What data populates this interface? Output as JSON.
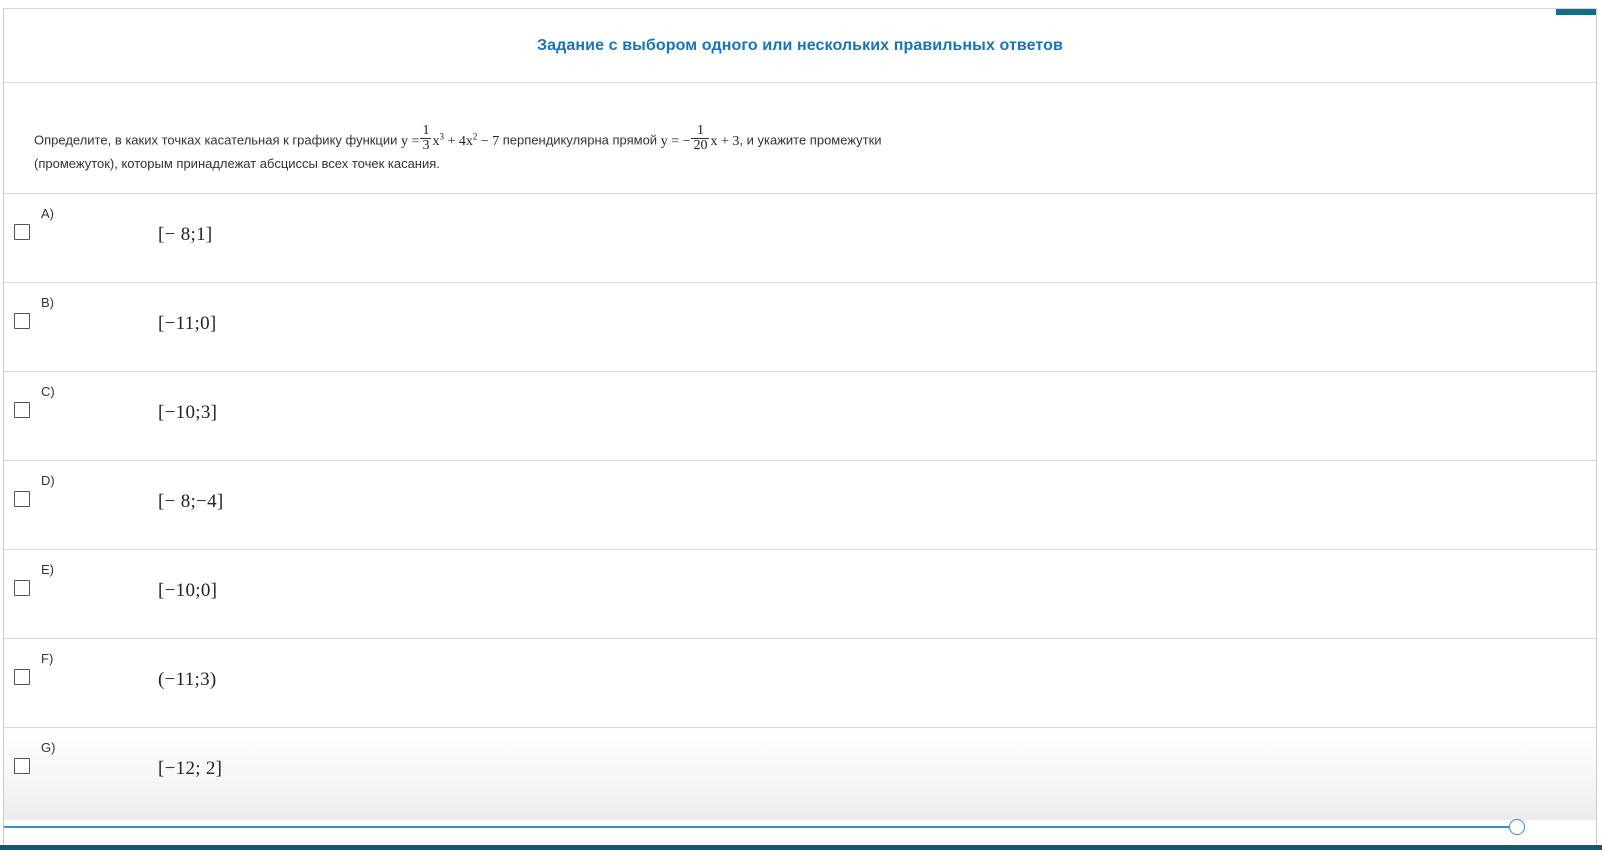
{
  "header": {
    "title": "Задание с выбором одного или нескольких правильных ответов"
  },
  "question": {
    "text_start": "Определите, в каких точках касательная к графику функции",
    "func_y": "y =",
    "func_frac_num": "1",
    "func_frac_den": "3",
    "func_rest_a": "x",
    "func_exp1": "3",
    "func_rest_b": "+ 4x",
    "func_exp2": "2",
    "func_rest_c": "− 7",
    "text_mid": "перпендикулярна прямой",
    "line_y": "y = −",
    "line_frac_num": "1",
    "line_frac_den": "20",
    "line_rest": "x + 3",
    "text_end": ", и укажите промежутки (промежуток), которым принадлежат абсциссы всех точек касания."
  },
  "options": [
    {
      "letter": "A)",
      "value": "[− 8;1]"
    },
    {
      "letter": "B)",
      "value": "[−11;0]"
    },
    {
      "letter": "C)",
      "value": "[−10;3]"
    },
    {
      "letter": "D)",
      "value": "[− 8;−4]"
    },
    {
      "letter": "E)",
      "value": "[−10;0]"
    },
    {
      "letter": "F)",
      "value": "(−11;3)"
    },
    {
      "letter": "G)",
      "value": "[−12; 2]"
    }
  ],
  "colors": {
    "title": "#1a73b5",
    "accent": "#0f6f8a",
    "scroll": "#3a8fc4"
  }
}
